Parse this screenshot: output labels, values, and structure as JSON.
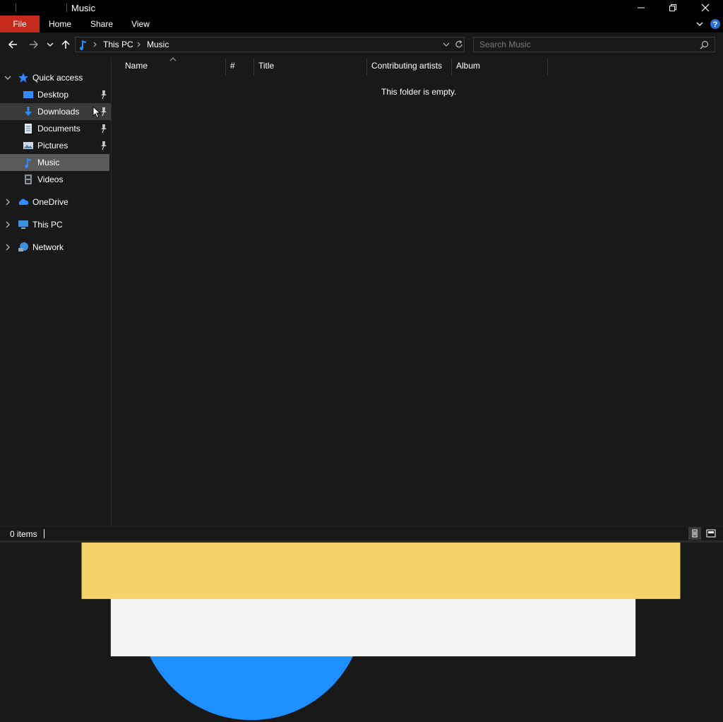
{
  "window": {
    "title": "Music",
    "accent": "#c42b1c",
    "background": "#191919"
  },
  "ribbon": {
    "tabs": [
      {
        "label": "File"
      },
      {
        "label": "Home"
      },
      {
        "label": "Share"
      },
      {
        "label": "View"
      }
    ]
  },
  "address": {
    "location_icon": "music-note-icon",
    "breadcrumbs": [
      {
        "label": "This PC"
      },
      {
        "label": "Music"
      }
    ]
  },
  "search": {
    "placeholder": "Search Music"
  },
  "nav_pane": {
    "quick_access": {
      "label": "Quick access",
      "items": [
        {
          "label": "Desktop",
          "icon": "desktop-icon",
          "pinned": true
        },
        {
          "label": "Downloads",
          "icon": "download-arrow-icon",
          "pinned": true
        },
        {
          "label": "Documents",
          "icon": "document-icon",
          "pinned": true
        },
        {
          "label": "Pictures",
          "icon": "pictures-icon",
          "pinned": true
        },
        {
          "label": "Music",
          "icon": "music-note-icon",
          "pinned": false,
          "selected": true
        },
        {
          "label": "Videos",
          "icon": "film-icon",
          "pinned": false
        }
      ]
    },
    "roots": [
      {
        "label": "OneDrive",
        "icon": "cloud-icon"
      },
      {
        "label": "This PC",
        "icon": "computer-icon"
      },
      {
        "label": "Network",
        "icon": "network-icon"
      }
    ]
  },
  "file_list": {
    "columns": [
      {
        "label": "Name"
      },
      {
        "label": "#"
      },
      {
        "label": "Title"
      },
      {
        "label": "Contributing artists"
      },
      {
        "label": "Album"
      }
    ],
    "empty_message": "This folder is empty."
  },
  "status_bar": {
    "item_count": "0 items"
  }
}
